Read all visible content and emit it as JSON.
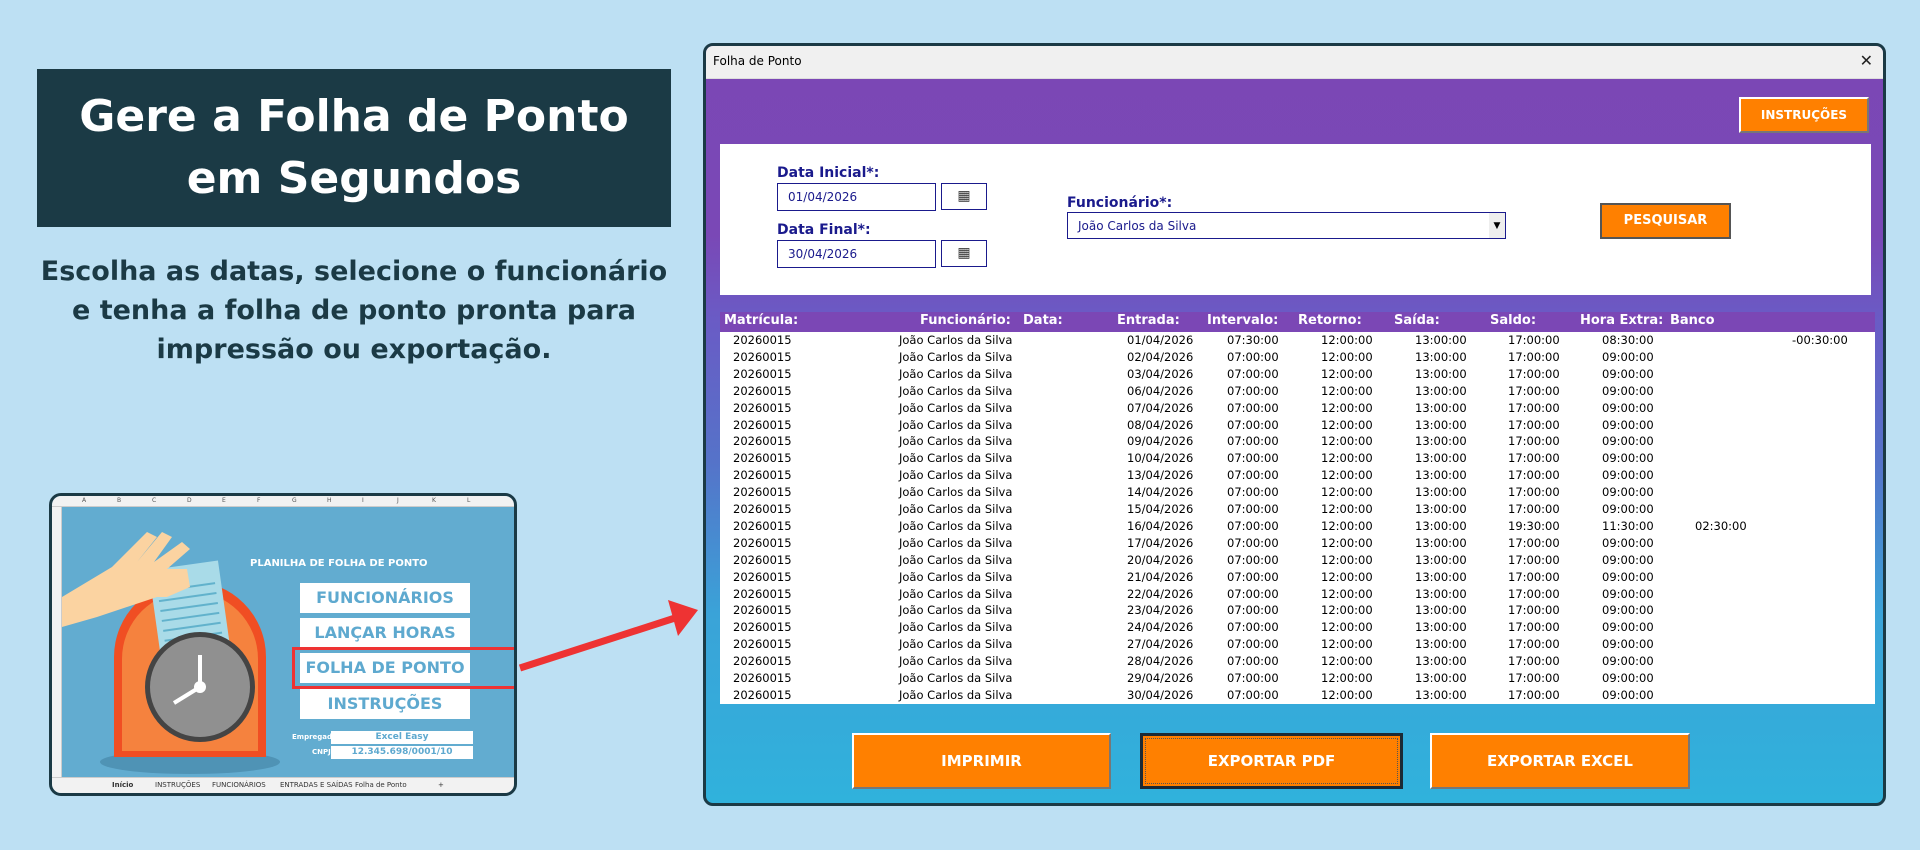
{
  "hero": {
    "title_line1": "Gere a Folha de Ponto",
    "title_line2": "em Segundos",
    "subtitle": "Escolha as datas, selecione o funcionário e tenha a folha de ponto pronta para impressão ou exportação."
  },
  "thumbnail": {
    "columns": [
      "A",
      "B",
      "C",
      "D",
      "E",
      "F",
      "G",
      "H",
      "I",
      "J",
      "K",
      "L"
    ],
    "heading": "PLANILHA DE FOLHA DE PONTO",
    "buttons": [
      "FUNCIONÁRIOS",
      "LANÇAR HORAS",
      "FOLHA DE PONTO",
      "INSTRUÇÕES"
    ],
    "employer_label": "Empregador",
    "employer_value": "Excel Easy",
    "cnpj_label": "CNPJ:",
    "cnpj_value": "12.345.698/0001/10",
    "tabs": [
      "Início",
      "INSTRUÇÕES",
      "FUNCIONÁRIOS",
      "ENTRADAS E SAÍDAS",
      "Folha de Ponto",
      "+"
    ],
    "highlight_color": "#ee3333"
  },
  "window": {
    "title": "Folha de Ponto",
    "close": "✕",
    "instructions_button": "INSTRUÇÕES",
    "data_inicial_label": "Data Inicial*:",
    "data_inicial": "01/04/2026",
    "data_final_label": "Data Final*:",
    "data_final": "30/04/2026",
    "funcionario_label": "Funcionário*:",
    "funcionario": "João Carlos da Silva",
    "search_button": "PESQUISAR",
    "buttons": {
      "print": "IMPRIMIR",
      "pdf": "EXPORTAR PDF",
      "excel": "EXPORTAR EXCEL"
    },
    "accent": "#ff8000",
    "header_color": "#7b47b5"
  },
  "table": {
    "headers": [
      "Matrícula:",
      "Funcionário:",
      "Data:",
      "Entrada:",
      "Intervalo:",
      "Retorno:",
      "Saída:",
      "Saldo:",
      "Hora Extra:",
      "Banco"
    ],
    "rows": [
      [
        "20260015",
        "João Carlos da Silva",
        "01/04/2026",
        "07:30:00",
        "12:00:00",
        "13:00:00",
        "17:00:00",
        "08:30:00",
        "",
        "-00:30:00"
      ],
      [
        "20260015",
        "João Carlos da Silva",
        "02/04/2026",
        "07:00:00",
        "12:00:00",
        "13:00:00",
        "17:00:00",
        "09:00:00",
        "",
        ""
      ],
      [
        "20260015",
        "João Carlos da Silva",
        "03/04/2026",
        "07:00:00",
        "12:00:00",
        "13:00:00",
        "17:00:00",
        "09:00:00",
        "",
        ""
      ],
      [
        "20260015",
        "João Carlos da Silva",
        "06/04/2026",
        "07:00:00",
        "12:00:00",
        "13:00:00",
        "17:00:00",
        "09:00:00",
        "",
        ""
      ],
      [
        "20260015",
        "João Carlos da Silva",
        "07/04/2026",
        "07:00:00",
        "12:00:00",
        "13:00:00",
        "17:00:00",
        "09:00:00",
        "",
        ""
      ],
      [
        "20260015",
        "João Carlos da Silva",
        "08/04/2026",
        "07:00:00",
        "12:00:00",
        "13:00:00",
        "17:00:00",
        "09:00:00",
        "",
        ""
      ],
      [
        "20260015",
        "João Carlos da Silva",
        "09/04/2026",
        "07:00:00",
        "12:00:00",
        "13:00:00",
        "17:00:00",
        "09:00:00",
        "",
        ""
      ],
      [
        "20260015",
        "João Carlos da Silva",
        "10/04/2026",
        "07:00:00",
        "12:00:00",
        "13:00:00",
        "17:00:00",
        "09:00:00",
        "",
        ""
      ],
      [
        "20260015",
        "João Carlos da Silva",
        "13/04/2026",
        "07:00:00",
        "12:00:00",
        "13:00:00",
        "17:00:00",
        "09:00:00",
        "",
        ""
      ],
      [
        "20260015",
        "João Carlos da Silva",
        "14/04/2026",
        "07:00:00",
        "12:00:00",
        "13:00:00",
        "17:00:00",
        "09:00:00",
        "",
        ""
      ],
      [
        "20260015",
        "João Carlos da Silva",
        "15/04/2026",
        "07:00:00",
        "12:00:00",
        "13:00:00",
        "17:00:00",
        "09:00:00",
        "",
        ""
      ],
      [
        "20260015",
        "João Carlos da Silva",
        "16/04/2026",
        "07:00:00",
        "12:00:00",
        "13:00:00",
        "19:30:00",
        "11:30:00",
        "02:30:00",
        ""
      ],
      [
        "20260015",
        "João Carlos da Silva",
        "17/04/2026",
        "07:00:00",
        "12:00:00",
        "13:00:00",
        "17:00:00",
        "09:00:00",
        "",
        ""
      ],
      [
        "20260015",
        "João Carlos da Silva",
        "20/04/2026",
        "07:00:00",
        "12:00:00",
        "13:00:00",
        "17:00:00",
        "09:00:00",
        "",
        ""
      ],
      [
        "20260015",
        "João Carlos da Silva",
        "21/04/2026",
        "07:00:00",
        "12:00:00",
        "13:00:00",
        "17:00:00",
        "09:00:00",
        "",
        ""
      ],
      [
        "20260015",
        "João Carlos da Silva",
        "22/04/2026",
        "07:00:00",
        "12:00:00",
        "13:00:00",
        "17:00:00",
        "09:00:00",
        "",
        ""
      ],
      [
        "20260015",
        "João Carlos da Silva",
        "23/04/2026",
        "07:00:00",
        "12:00:00",
        "13:00:00",
        "17:00:00",
        "09:00:00",
        "",
        ""
      ],
      [
        "20260015",
        "João Carlos da Silva",
        "24/04/2026",
        "07:00:00",
        "12:00:00",
        "13:00:00",
        "17:00:00",
        "09:00:00",
        "",
        ""
      ],
      [
        "20260015",
        "João Carlos da Silva",
        "27/04/2026",
        "07:00:00",
        "12:00:00",
        "13:00:00",
        "17:00:00",
        "09:00:00",
        "",
        ""
      ],
      [
        "20260015",
        "João Carlos da Silva",
        "28/04/2026",
        "07:00:00",
        "12:00:00",
        "13:00:00",
        "17:00:00",
        "09:00:00",
        "",
        ""
      ],
      [
        "20260015",
        "João Carlos da Silva",
        "29/04/2026",
        "07:00:00",
        "12:00:00",
        "13:00:00",
        "17:00:00",
        "09:00:00",
        "",
        ""
      ],
      [
        "20260015",
        "João Carlos da Silva",
        "30/04/2026",
        "07:00:00",
        "12:00:00",
        "13:00:00",
        "17:00:00",
        "09:00:00",
        "",
        ""
      ]
    ]
  }
}
